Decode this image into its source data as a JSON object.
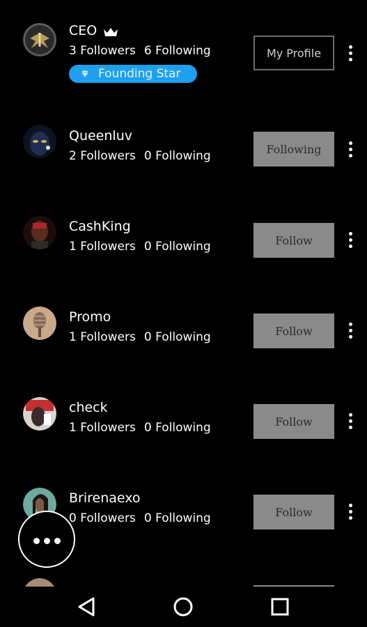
{
  "users": [
    {
      "name": "CEO",
      "followers_text": "3 Followers",
      "following_text": "6 Following",
      "button_label": "My Profile",
      "badge_label": "Founding Star",
      "has_crown": true
    },
    {
      "name": "Queenluv",
      "followers_text": "2 Followers",
      "following_text": "0 Following",
      "button_label": "Following"
    },
    {
      "name": "CashKing",
      "followers_text": "1 Followers",
      "following_text": "0 Following",
      "button_label": "Follow"
    },
    {
      "name": "Promo",
      "followers_text": "1 Followers",
      "following_text": "0 Following",
      "button_label": "Follow"
    },
    {
      "name": "check",
      "followers_text": "1 Followers",
      "following_text": "0 Following",
      "button_label": "Follow"
    },
    {
      "name": "Brirenaexo",
      "followers_text": "0 Followers",
      "following_text": "0 Following",
      "button_label": "Follow"
    }
  ],
  "icons": {
    "crown": "crown-icon",
    "badge": "diamond-icon",
    "more": "more-vertical-icon",
    "fab": "more-horizontal-icon",
    "nav_back": "triangle-back-icon",
    "nav_home": "circle-home-icon",
    "nav_recent": "square-recents-icon"
  },
  "colors": {
    "background": "#000000",
    "badge": "#1ea0f0",
    "follow_button": "#8a8a8a",
    "text": "#ffffff"
  }
}
